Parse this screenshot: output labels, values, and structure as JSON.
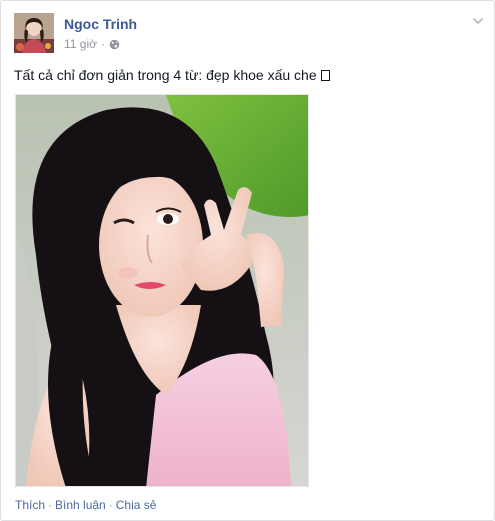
{
  "post": {
    "author": "Ngoc Trinh",
    "timestamp": "11 giờ",
    "separator": "·",
    "privacy_icon": "globe-icon",
    "text": "Tất cả chỉ đơn giản trong 4 từ: đẹp khoe xấu che",
    "menu_icon": "chevron-down-icon"
  },
  "actions": {
    "like_label": "Thích",
    "comment_label": "Bình luận",
    "share_label": "Chia sẻ",
    "separator": "·"
  },
  "colors": {
    "link_blue": "#3b5998",
    "action_blue": "#4e69a2",
    "meta_gray": "#90949c",
    "text": "#141823"
  }
}
